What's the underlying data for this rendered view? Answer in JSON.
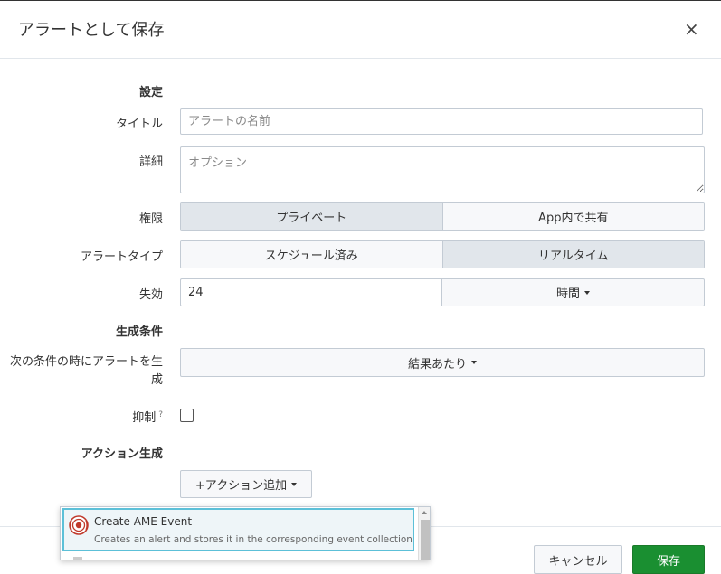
{
  "dialog": {
    "title": "アラートとして保存",
    "close_glyph": "×"
  },
  "sections": {
    "settings": "設定",
    "trigger_conditions": "生成条件",
    "trigger_actions": "アクション生成"
  },
  "fields": {
    "title": {
      "label": "タイトル",
      "placeholder": "アラートの名前",
      "value": ""
    },
    "description": {
      "label": "詳細",
      "placeholder": "オプション",
      "value": ""
    },
    "permissions": {
      "label": "権限",
      "options": [
        "プライベート",
        "App内で共有"
      ],
      "selected": "プライベート"
    },
    "alert_type": {
      "label": "アラートタイプ",
      "options": [
        "スケジュール済み",
        "リアルタイム"
      ],
      "selected": "リアルタイム"
    },
    "expires": {
      "label": "失効",
      "value": "24",
      "unit": "時間"
    },
    "trigger_alert_when": {
      "label": "次の条件の時にアラートを生成",
      "value": "結果あたり"
    },
    "throttle": {
      "label": "抑制",
      "help": "?",
      "checked": false
    },
    "add_actions": {
      "label": "+アクション追加"
    }
  },
  "dropdown": {
    "items": [
      {
        "title": "Create AME Event",
        "description": "Creates an alert and stores it in the corresponding event collection",
        "icon": "ame-alarm-icon"
      }
    ]
  },
  "footer": {
    "cancel_label": "キャンセル",
    "save_label": "保存"
  },
  "colors": {
    "primary": "#1a8f31",
    "border": "#c3cbd4",
    "highlight": "#5cc0d8",
    "icon_red": "#c0392b"
  }
}
